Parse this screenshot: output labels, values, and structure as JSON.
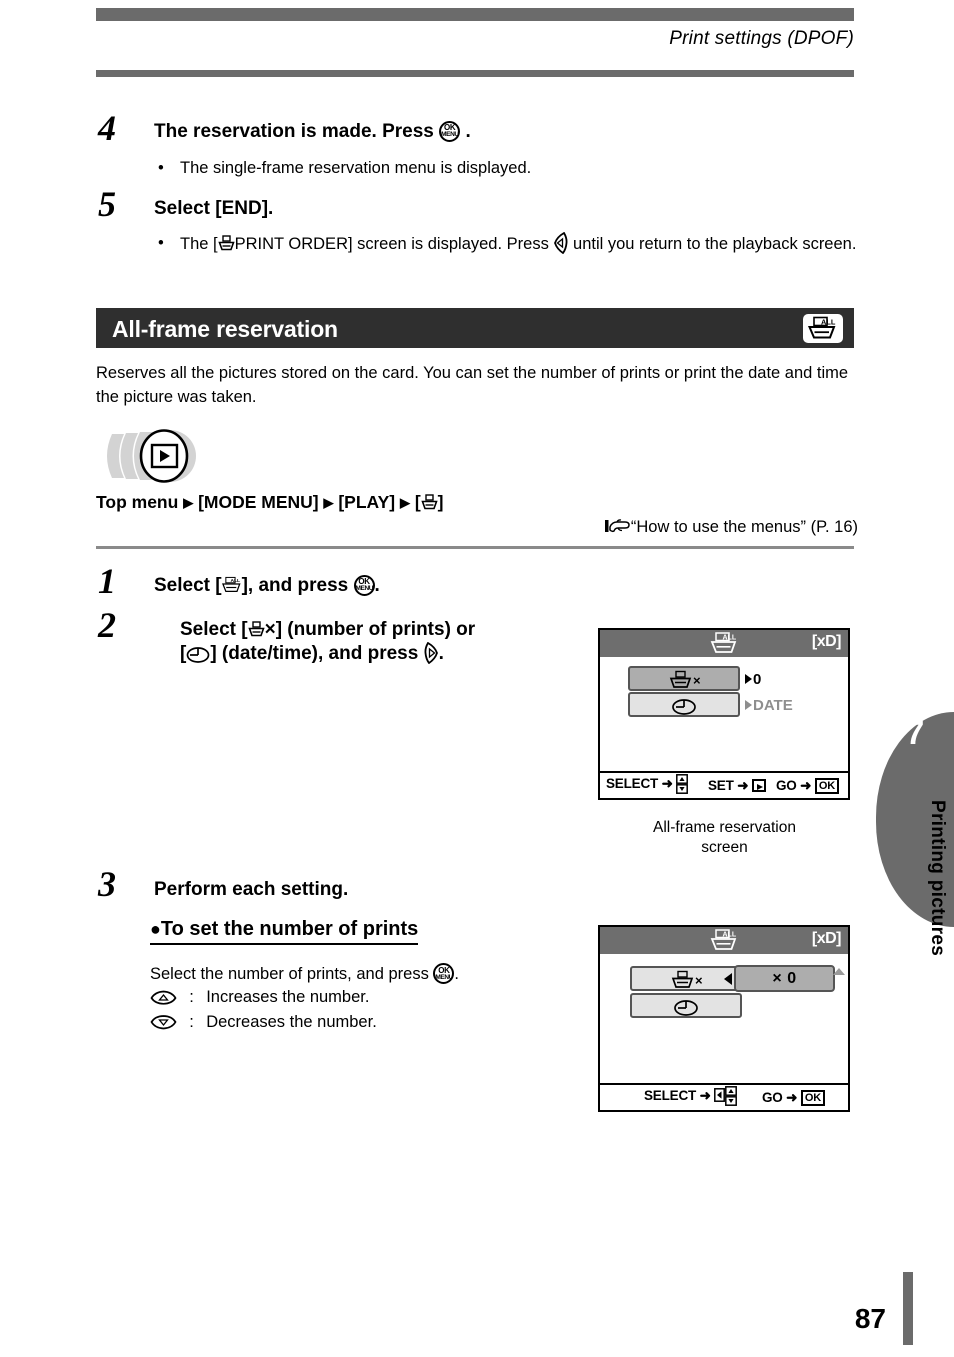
{
  "header": {
    "running_title": "Print settings (DPOF)"
  },
  "steps_top": [
    {
      "number": "4",
      "heading_pre": "The reservation is made. Press",
      "heading_icon": "ok-menu-button-icon",
      "heading_post": ".",
      "bullets": [
        {
          "text": "The single-frame reservation menu is displayed."
        }
      ]
    },
    {
      "number": "5",
      "heading_pre": "Select [END].",
      "bullets": [
        {
          "pre": "The [",
          "icon1": "printer-icon",
          "mid": "PRINT ORDER] screen is displayed. Press",
          "icon2": "arrow-left-pad-icon",
          "post": "until you return to the playback screen."
        }
      ]
    }
  ],
  "section": {
    "title": "All-frame reservation",
    "badge_icon": "printer-all-icon",
    "description": "Reserves all the pictures stored on the card. You can set the number of prints or print the date and time the picture was taken.",
    "mode_icon": "playback-mode-icon",
    "menu_path": {
      "start": "Top menu",
      "arrow": "▶",
      "item1": "[MODE MENU]",
      "item2": "[PLAY]",
      "item3_open": "[",
      "item3_icon": "printer-icon",
      "item3_close": "]"
    },
    "reference": {
      "icon": "pointing-hand-icon",
      "text": "“How to use the menus” (P. 16)"
    }
  },
  "steps_main": [
    {
      "number": "1",
      "line_pre": "Select [",
      "icon_inline": "printer-all-icon",
      "line_mid": "], and press",
      "icon_inline2": "ok-menu-button-icon",
      "line_post": "."
    },
    {
      "number": "2",
      "l1_pre": "Select [",
      "l1_icon": "printer-icon",
      "l1_mid": "×] (number of prints) or",
      "l2_open": "[",
      "l2_icon": "clock-icon",
      "l2_mid": "] (date/time), and press",
      "l2_icon2": "arrow-right-pad-icon",
      "l2_post": "."
    },
    {
      "number": "3",
      "heading": "Perform each setting.",
      "sub": {
        "disc": "●",
        "title": "To set the number of prints",
        "body_pre": "Select the number of prints, and press",
        "body_icon": "ok-menu-button-icon",
        "body_post": ".",
        "keys": [
          {
            "icon": "arrow-up-pad-icon",
            "sep": ":",
            "desc": "Increases the number."
          },
          {
            "icon": "arrow-down-pad-icon",
            "sep": ":",
            "desc": "Decreases the number."
          }
        ]
      }
    }
  ],
  "lcd_screens": [
    {
      "name": "all-frame-reservation-screen",
      "titlebar": {
        "icon": "printer-all-icon",
        "card": "[xD]"
      },
      "rows": [
        {
          "icon": "printer-times-icon",
          "selected": true,
          "value": "0",
          "value_marker": "▶"
        },
        {
          "icon": "clock-icon",
          "selected": false,
          "value": "DATE",
          "value_marker": "▶"
        }
      ],
      "hints": [
        {
          "label": "SELECT",
          "arrow": "➜",
          "key": "updown-pad-icon"
        },
        {
          "label": "SET",
          "arrow": "➜",
          "key": "arrow-right-box-icon"
        },
        {
          "label": "GO",
          "arrow": "➜",
          "key": "OK"
        }
      ],
      "caption_line1": "All-frame reservation",
      "caption_line2": "screen"
    },
    {
      "name": "number-of-prints-screen",
      "titlebar": {
        "icon": "printer-all-icon",
        "card": "[xD]"
      },
      "rows": [
        {
          "icon": "printer-times-icon",
          "selected": false
        },
        {
          "icon": "clock-icon",
          "selected": false
        }
      ],
      "value_box": "× 0",
      "hints": [
        {
          "label": "SELECT",
          "arrow": "➜",
          "key": "left-updown-pad-icon"
        },
        {
          "label": "GO",
          "arrow": "➜",
          "key": "OK"
        }
      ]
    }
  ],
  "chapter_tab": {
    "number": "7",
    "title": "Printing pictures"
  },
  "footer": {
    "page_number": "87"
  },
  "colors": {
    "band_dark": "#2f2f2f",
    "rule_gray": "#6b6b6b",
    "lcd_titlebar": "#6e6e6e",
    "row_selected": "#adadad",
    "row_unselected": "#e3e3e3"
  }
}
